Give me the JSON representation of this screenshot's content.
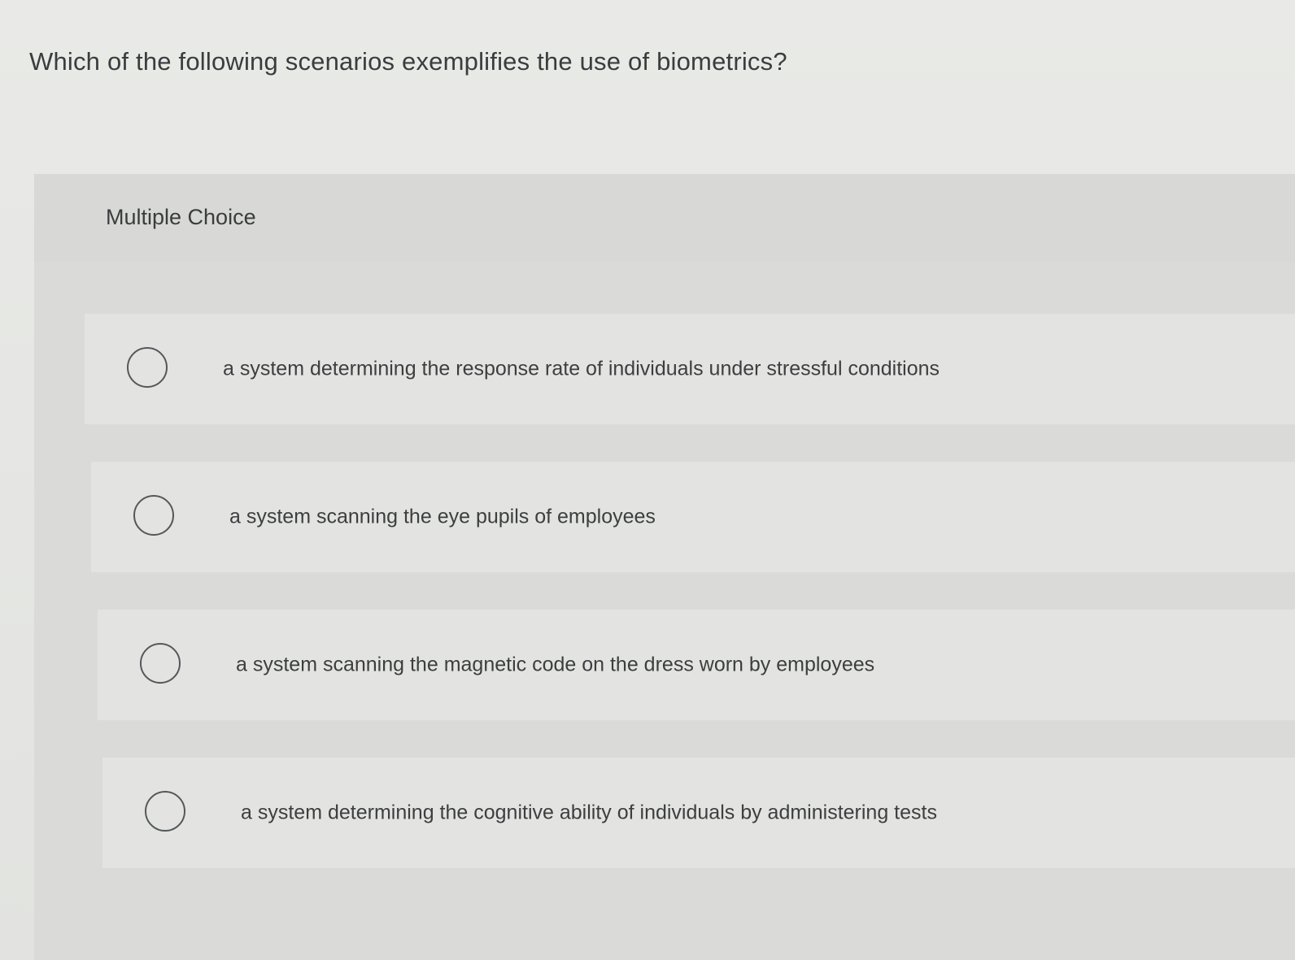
{
  "question": {
    "text": "Which of the following scenarios exemplifies the use of biometrics?"
  },
  "multiple_choice": {
    "label": "Multiple Choice",
    "options": [
      {
        "text": "a system determining the response rate of individuals under stressful conditions",
        "selected": false
      },
      {
        "text": "a system scanning the eye pupils of employees",
        "selected": false
      },
      {
        "text": "a system scanning the magnetic code on the dress worn by employees",
        "selected": false
      },
      {
        "text": "a system determining the cognitive ability of individuals by administering tests",
        "selected": false
      }
    ]
  },
  "colors": {
    "background": "#e9eae7",
    "panel": "#dadbd8",
    "option_row": "#e3e4e1",
    "text": "#3a3c3e",
    "radio_border": "#55585b"
  },
  "icons": {
    "radio": "radio-button-empty-icon"
  }
}
